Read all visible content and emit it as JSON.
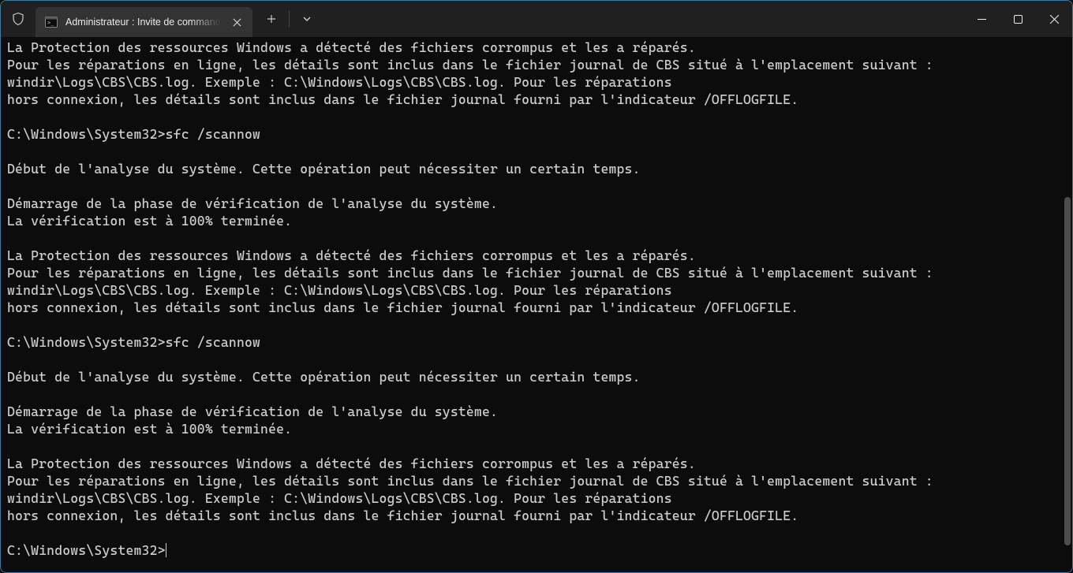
{
  "tab": {
    "title": "Administrateur : Invite de commandes"
  },
  "terminal": {
    "lines": [
      "La Protection des ressources Windows a détecté des fichiers corrompus et les a réparés.",
      "Pour les réparations en ligne, les détails sont inclus dans le fichier journal de CBS situé à l'emplacement suivant :",
      "windir\\Logs\\CBS\\CBS.log. Exemple : C:\\Windows\\Logs\\CBS\\CBS.log. Pour les réparations",
      "hors connexion, les détails sont inclus dans le fichier journal fourni par l'indicateur /OFFLOGFILE.",
      "",
      "C:\\Windows\\System32>sfc /scannow",
      "",
      "Début de l'analyse du système. Cette opération peut nécessiter un certain temps.",
      "",
      "Démarrage de la phase de vérification de l'analyse du système.",
      "La vérification est à 100% terminée.",
      "",
      "La Protection des ressources Windows a détecté des fichiers corrompus et les a réparés.",
      "Pour les réparations en ligne, les détails sont inclus dans le fichier journal de CBS situé à l'emplacement suivant :",
      "windir\\Logs\\CBS\\CBS.log. Exemple : C:\\Windows\\Logs\\CBS\\CBS.log. Pour les réparations",
      "hors connexion, les détails sont inclus dans le fichier journal fourni par l'indicateur /OFFLOGFILE.",
      "",
      "C:\\Windows\\System32>sfc /scannow",
      "",
      "Début de l'analyse du système. Cette opération peut nécessiter un certain temps.",
      "",
      "Démarrage de la phase de vérification de l'analyse du système.",
      "La vérification est à 100% terminée.",
      "",
      "La Protection des ressources Windows a détecté des fichiers corrompus et les a réparés.",
      "Pour les réparations en ligne, les détails sont inclus dans le fichier journal de CBS situé à l'emplacement suivant :",
      "windir\\Logs\\CBS\\CBS.log. Exemple : C:\\Windows\\Logs\\CBS\\CBS.log. Pour les réparations",
      "hors connexion, les détails sont inclus dans le fichier journal fourni par l'indicateur /OFFLOGFILE.",
      ""
    ],
    "prompt": "C:\\Windows\\System32>"
  }
}
